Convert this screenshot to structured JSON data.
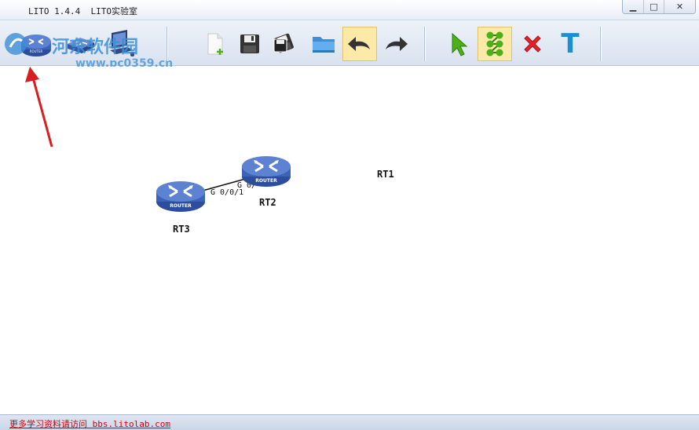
{
  "window": {
    "title": "LITO 1.4.4  LITO实验室",
    "controls": {
      "minimize": "▁",
      "maximize": "□",
      "close": "✕"
    }
  },
  "watermark": {
    "text": "河东软件园",
    "url": "www.pc0359.cn"
  },
  "toolbar": {
    "device_tools": [
      {
        "name": "router-tool",
        "icon": "router-icon",
        "label": "ROUTER"
      },
      {
        "name": "switch-tool",
        "icon": "switch-icon"
      },
      {
        "name": "pc-tool",
        "icon": "pc-icon"
      }
    ],
    "file_tools": [
      {
        "name": "new-file-button",
        "icon": "new-file-icon"
      },
      {
        "name": "save-button",
        "icon": "save-icon"
      },
      {
        "name": "save-as-button",
        "icon": "save-as-icon"
      },
      {
        "name": "open-folder-button",
        "icon": "folder-icon"
      },
      {
        "name": "undo-button",
        "icon": "undo-icon",
        "active": true
      },
      {
        "name": "redo-button",
        "icon": "redo-icon"
      }
    ],
    "edit_tools": [
      {
        "name": "select-button",
        "icon": "pointer-icon"
      },
      {
        "name": "connect-button",
        "icon": "link-nodes-icon",
        "active": true
      },
      {
        "name": "delete-button",
        "icon": "delete-x-icon"
      },
      {
        "name": "text-button",
        "icon": "text-icon",
        "glyph": "T"
      }
    ]
  },
  "canvas": {
    "nodes": [
      {
        "id": "RT1",
        "label": "RT1",
        "has_icon": false
      },
      {
        "id": "RT2",
        "label": "RT2",
        "device_text": "ROUTER"
      },
      {
        "id": "RT3",
        "label": "RT3",
        "device_text": "ROUTER"
      }
    ],
    "links": [
      {
        "from": "RT3",
        "to": "RT2",
        "from_port": "G 0/0/1",
        "to_port": "G 0/"
      }
    ]
  },
  "colors": {
    "router_body": "#3d63b8",
    "router_top": "#5d82d1",
    "annotation_arrow": "#d81e1e",
    "status_link": "#d40000",
    "active_tool": "#fde9a8"
  },
  "status": {
    "link_text": "更多学习资料请访问 bbs.litolab.com"
  }
}
